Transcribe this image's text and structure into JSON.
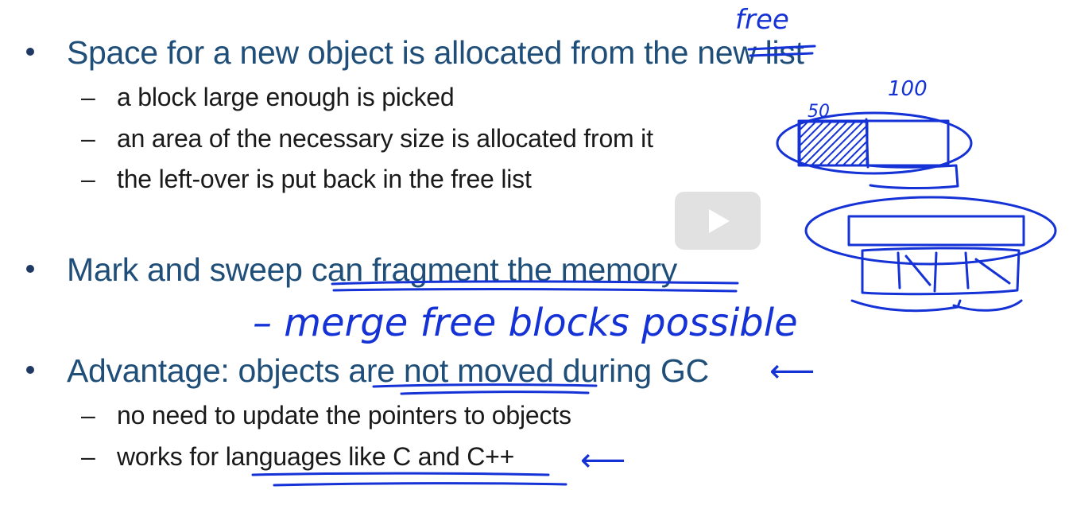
{
  "slide": {
    "bullets": [
      {
        "text": "Space for a new object is allocated from the new list",
        "subs": [
          "a block large enough is picked",
          "an area of the necessary size is allocated from it",
          "the left-over is put back in the free list"
        ]
      },
      {
        "text": "Mark and sweep can fragment the memory",
        "subs": []
      },
      {
        "text": "Advantage: objects are not moved during GC",
        "subs": [
          "no need to update the pointers to objects",
          "works for languages like C and C++"
        ]
      }
    ],
    "dash_glyph": "–"
  },
  "annotations": {
    "free_over_new": "free",
    "label_100": "100",
    "label_50": "50",
    "merge_note": "– merge free blocks possible",
    "arrow_gc": "⟵",
    "arrow_c": "⟵"
  },
  "video": {
    "play_icon": "play-icon"
  },
  "colors": {
    "bullet_text": "#1f4e79",
    "sub_text": "#1a1a1a",
    "ink": "#1432d6"
  }
}
